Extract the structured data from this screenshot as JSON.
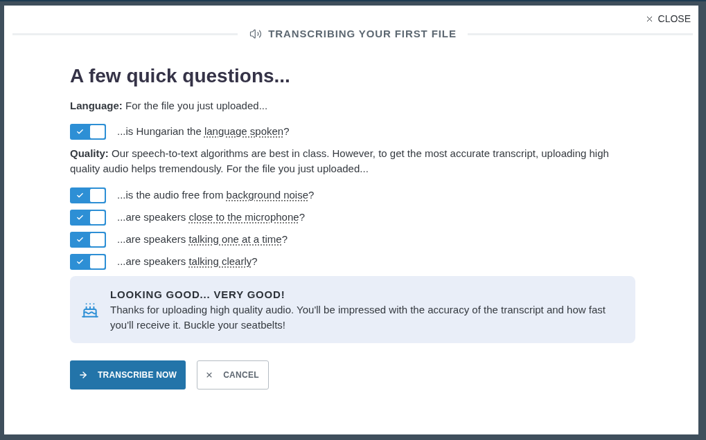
{
  "close_button": {
    "label": "CLOSE"
  },
  "header": {
    "title": "TRANSCRIBING YOUR FIRST FILE"
  },
  "heading": "A few quick questions...",
  "sections": [
    {
      "intro": "**Language:** For the file you just uploaded...",
      "questions": [
        {
          "before": "...is Hungarian the",
          "term": "language spoken",
          "after": "?",
          "checked": true
        }
      ]
    },
    {
      "intro": "**Quality:** Our speech-to-text algorithms are best in class. However, to get the most accurate transcript, uploading high quality audio helps tremendously. For the file you just uploaded...",
      "questions": [
        {
          "before": "...is the audio free from",
          "term": "background noise",
          "after": "?",
          "checked": true
        },
        {
          "before": "...are speakers",
          "term": "close to the microphone",
          "after": "?",
          "checked": true
        },
        {
          "before": "...are speakers",
          "term": "talking one at a time",
          "after": "?",
          "checked": true
        },
        {
          "before": "...are speakers",
          "term": "talking clearly",
          "after": "?",
          "checked": true
        }
      ]
    }
  ],
  "notice": {
    "title": "LOOKING GOOD... VERY GOOD!",
    "text": "Thanks for uploading high quality audio. You'll be impressed with the accuracy of the transcript and how fast you'll receive it. Buckle your seatbelts!"
  },
  "buttons": [
    {
      "label": "TRANSCRIBE NOW",
      "kind": "primary"
    },
    {
      "label": "CANCEL",
      "kind": "secondary"
    }
  ]
}
